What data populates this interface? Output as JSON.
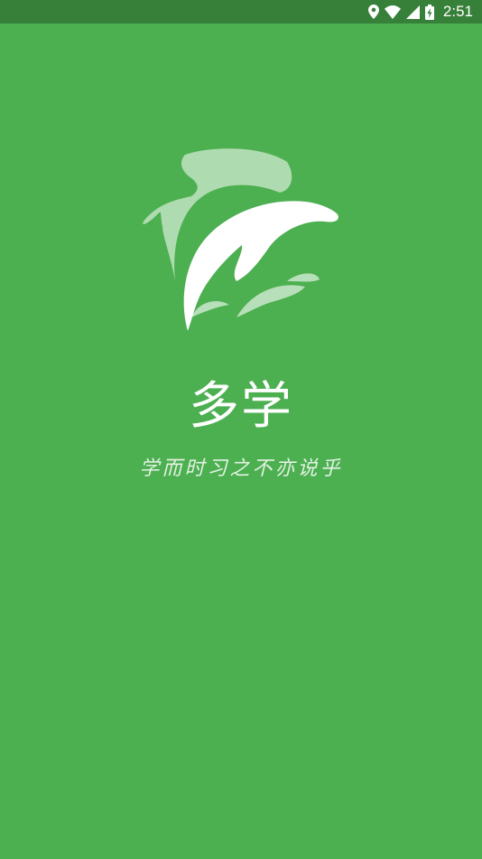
{
  "status_bar": {
    "time": "2:51",
    "icons": [
      "location-icon",
      "wifi-icon",
      "signal-icon",
      "battery-charging-icon"
    ]
  },
  "splash": {
    "logo": "dolphin-logo",
    "app_name": "多学",
    "slogan": "学而时习之不亦说乎"
  },
  "colors": {
    "background": "#4caf50",
    "status_bar": "#37803a",
    "text": "#ffffff"
  }
}
